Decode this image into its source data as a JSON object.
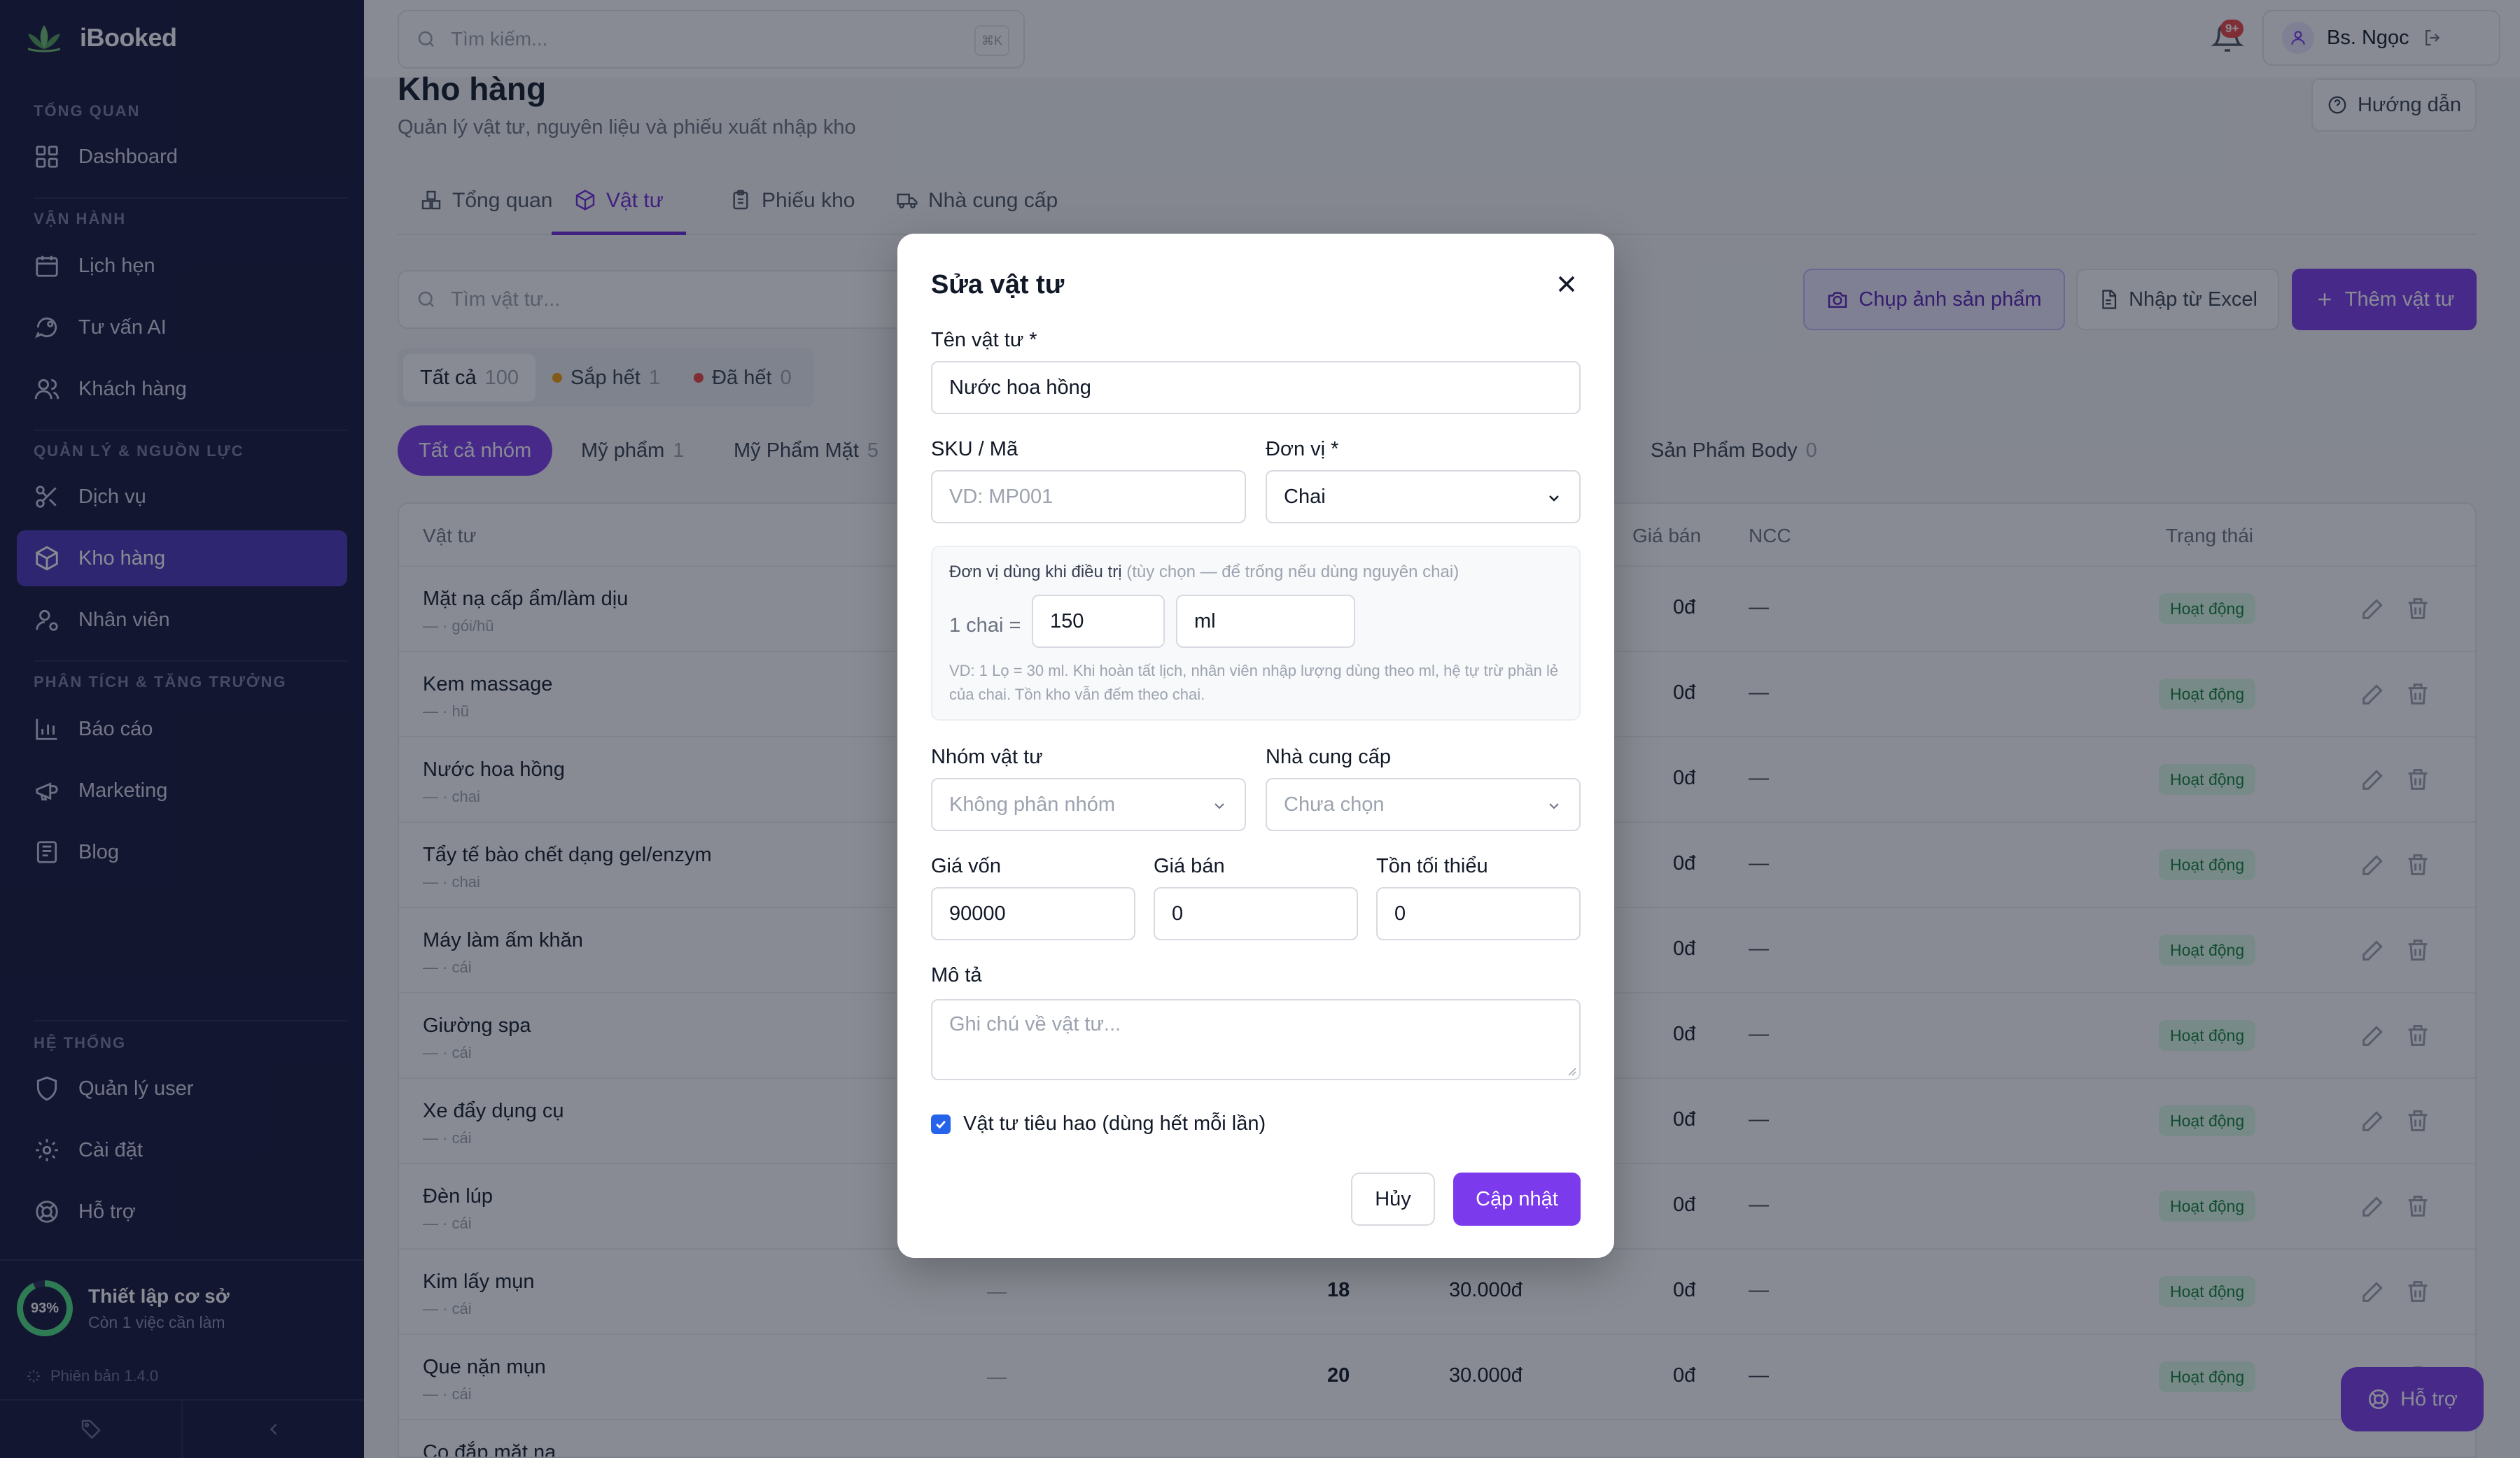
{
  "app": {
    "name": "iBooked",
    "version": "Phiên bản 1.4.0"
  },
  "topbar": {
    "search_placeholder": "Tìm kiếm...",
    "shortcut": "⌘K",
    "notif_count": "9+",
    "user_name": "Bs. Ngọc"
  },
  "sidebar": {
    "sections": {
      "overview": "TỔNG QUAN",
      "ops": "VẬN HÀNH",
      "resources": "QUẢN LÝ & NGUỒN LỰC",
      "growth": "PHÂN TÍCH & TĂNG TRƯỞNG",
      "system": "HỆ THỐNG"
    },
    "items": {
      "dashboard": "Dashboard",
      "calendar": "Lịch hẹn",
      "ai": "Tư vấn AI",
      "customers": "Khách hàng",
      "services": "Dịch vụ",
      "inventory": "Kho hàng",
      "staff": "Nhân viên",
      "reports": "Báo cáo",
      "marketing": "Marketing",
      "blog": "Blog",
      "users": "Quản lý user",
      "settings": "Cài đặt",
      "support": "Hỗ trợ"
    },
    "setup": {
      "percent": "93%",
      "percent_value": 0.93,
      "title": "Thiết lập cơ sở",
      "subtitle": "Còn 1 việc cần làm"
    }
  },
  "page": {
    "title": "Kho hàng",
    "subtitle": "Quản lý vật tư, nguyên liệu và phiếu xuất nhập kho",
    "guide": "Hướng dẫn"
  },
  "tabs": [
    "Tổng quan",
    "Vật tư",
    "Phiếu kho",
    "Nhà cung cấp"
  ],
  "toolbar": {
    "search_placeholder": "Tìm vật tư...",
    "photo": "Chụp ảnh sản phẩm",
    "excel": "Nhập từ Excel",
    "add": "Thêm vật tư"
  },
  "filters": [
    {
      "label": "Tất cả",
      "count": "100"
    },
    {
      "label": "Sắp hết",
      "count": "1",
      "color": "#f59e0b"
    },
    {
      "label": "Đã hết",
      "count": "0",
      "color": "#ef4444"
    }
  ],
  "groups": [
    {
      "label": "Tất cả nhóm",
      "count": ""
    },
    {
      "label": "Mỹ phẩm",
      "count": "1"
    },
    {
      "label": "Mỹ Phẩm Mặt",
      "count": "5"
    },
    {
      "label": "Sản Phẩm Body",
      "count": "0"
    }
  ],
  "table": {
    "headers": {
      "item": "Vật tư",
      "price": "Giá bán",
      "ncc": "NCC",
      "status": "Trạng thái"
    },
    "rows": [
      {
        "name": "Mặt nạ cấp ẩm/làm dịu",
        "unit": "— · gói/hũ",
        "price": "0đ",
        "ncc": "—",
        "status": "Hoạt động"
      },
      {
        "name": "Kem massage",
        "unit": "— · hũ",
        "price": "0đ",
        "ncc": "—",
        "status": "Hoạt động"
      },
      {
        "name": "Nước hoa hồng",
        "unit": "— · chai",
        "price": "0đ",
        "ncc": "—",
        "status": "Hoạt động"
      },
      {
        "name": "Tẩy tế bào chết dạng gel/enzym",
        "unit": "— · chai",
        "price": "0đ",
        "ncc": "—",
        "status": "Hoạt động"
      },
      {
        "name": "Máy làm ấm khăn",
        "unit": "— · cái",
        "price": "0đ",
        "ncc": "—",
        "status": "Hoạt động"
      },
      {
        "name": "Giường spa",
        "unit": "— · cái",
        "price": "0đ",
        "ncc": "—",
        "status": "Hoạt động"
      },
      {
        "name": "Xe đẩy dụng cụ",
        "unit": "— · cái",
        "price": "0đ",
        "ncc": "—",
        "status": "Hoạt động"
      },
      {
        "name": "Đèn lúp",
        "unit": "— · cái",
        "price": "0đ",
        "ncc": "—",
        "status": "Hoạt động"
      },
      {
        "name": "Kim lấy mụn",
        "unit": "— · cái",
        "code": "—",
        "qty": "18",
        "cost": "30.000đ",
        "price": "0đ",
        "ncc": "—",
        "status": "Hoạt động"
      },
      {
        "name": "Que nặn mụn",
        "unit": "— · cái",
        "code": "—",
        "qty": "20",
        "cost": "30.000đ",
        "price": "0đ",
        "ncc": "—",
        "status": "Hoạt động"
      },
      {
        "name": "Cọ đắp mặt nạ",
        "unit": "",
        "price": "",
        "ncc": "",
        "status": ""
      }
    ]
  },
  "help_fab": "Hỗ trợ",
  "modal": {
    "title": "Sửa vật tư",
    "name_label": "Tên vật tư *",
    "name_value": "Nước hoa hồng",
    "sku_label": "SKU / Mã",
    "sku_placeholder": "VD: MP001",
    "unit_label": "Đơn vị *",
    "unit_value": "Chai",
    "usage_title": "Đơn vị dùng khi điều trị",
    "usage_hint": "(tùy chọn — để trống nếu dùng nguyên chai)",
    "usage_eq": "1 chai =",
    "usage_qty": "150",
    "usage_unit": "ml",
    "usage_note": "VD: 1 Lọ = 30 ml. Khi hoàn tất lịch, nhân viên nhập lượng dùng theo ml, hệ tự trừ phần lẻ của chai. Tồn kho vẫn đếm theo chai.",
    "group_label": "Nhóm vật tư",
    "group_value": "Không phân nhóm",
    "supplier_label": "Nhà cung cấp",
    "supplier_value": "Chưa chọn",
    "cost_label": "Giá vốn",
    "cost_value": "90000",
    "price_label": "Giá bán",
    "price_value": "0",
    "min_label": "Tồn tối thiểu",
    "min_value": "0",
    "desc_label": "Mô tả",
    "desc_placeholder": "Ghi chú về vật tư...",
    "consumable_label": "Vật tư tiêu hao (dùng hết mỗi lần)",
    "cancel": "Hủy",
    "save": "Cập nhật"
  }
}
